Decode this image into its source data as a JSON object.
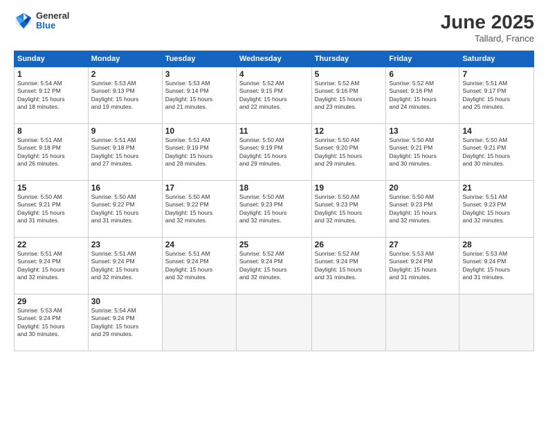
{
  "header": {
    "logo_general": "General",
    "logo_blue": "Blue",
    "month_title": "June 2025",
    "location": "Tallard, France"
  },
  "calendar": {
    "days_of_week": [
      "Sunday",
      "Monday",
      "Tuesday",
      "Wednesday",
      "Thursday",
      "Friday",
      "Saturday"
    ],
    "weeks": [
      [
        {
          "day": "",
          "empty": true
        },
        {
          "day": "2",
          "sunrise": "5:53 AM",
          "sunset": "9:13 PM",
          "daylight": "Daylight: 15 hours and 19 minutes."
        },
        {
          "day": "3",
          "sunrise": "5:53 AM",
          "sunset": "9:14 PM",
          "daylight": "Daylight: 15 hours and 21 minutes."
        },
        {
          "day": "4",
          "sunrise": "5:52 AM",
          "sunset": "9:15 PM",
          "daylight": "Daylight: 15 hours and 22 minutes."
        },
        {
          "day": "5",
          "sunrise": "5:52 AM",
          "sunset": "9:16 PM",
          "daylight": "Daylight: 15 hours and 23 minutes."
        },
        {
          "day": "6",
          "sunrise": "5:52 AM",
          "sunset": "9:16 PM",
          "daylight": "Daylight: 15 hours and 24 minutes."
        },
        {
          "day": "7",
          "sunrise": "5:51 AM",
          "sunset": "9:17 PM",
          "daylight": "Daylight: 15 hours and 25 minutes."
        }
      ],
      [
        {
          "day": "1",
          "sunrise": "5:54 AM",
          "sunset": "9:12 PM",
          "daylight": "Daylight: 15 hours and 18 minutes."
        },
        {
          "day": "",
          "empty": true
        },
        {
          "day": "",
          "empty": true
        },
        {
          "day": "",
          "empty": true
        },
        {
          "day": "",
          "empty": true
        },
        {
          "day": "",
          "empty": true
        },
        {
          "day": "",
          "empty": true
        }
      ],
      [
        {
          "day": "8",
          "sunrise": "5:51 AM",
          "sunset": "9:18 PM",
          "daylight": "Daylight: 15 hours and 26 minutes."
        },
        {
          "day": "9",
          "sunrise": "5:51 AM",
          "sunset": "9:18 PM",
          "daylight": "Daylight: 15 hours and 27 minutes."
        },
        {
          "day": "10",
          "sunrise": "5:51 AM",
          "sunset": "9:19 PM",
          "daylight": "Daylight: 15 hours and 28 minutes."
        },
        {
          "day": "11",
          "sunrise": "5:50 AM",
          "sunset": "9:19 PM",
          "daylight": "Daylight: 15 hours and 29 minutes."
        },
        {
          "day": "12",
          "sunrise": "5:50 AM",
          "sunset": "9:20 PM",
          "daylight": "Daylight: 15 hours and 29 minutes."
        },
        {
          "day": "13",
          "sunrise": "5:50 AM",
          "sunset": "9:21 PM",
          "daylight": "Daylight: 15 hours and 30 minutes."
        },
        {
          "day": "14",
          "sunrise": "5:50 AM",
          "sunset": "9:21 PM",
          "daylight": "Daylight: 15 hours and 30 minutes."
        }
      ],
      [
        {
          "day": "15",
          "sunrise": "5:50 AM",
          "sunset": "9:21 PM",
          "daylight": "Daylight: 15 hours and 31 minutes."
        },
        {
          "day": "16",
          "sunrise": "5:50 AM",
          "sunset": "9:22 PM",
          "daylight": "Daylight: 15 hours and 31 minutes."
        },
        {
          "day": "17",
          "sunrise": "5:50 AM",
          "sunset": "9:22 PM",
          "daylight": "Daylight: 15 hours and 32 minutes."
        },
        {
          "day": "18",
          "sunrise": "5:50 AM",
          "sunset": "9:23 PM",
          "daylight": "Daylight: 15 hours and 32 minutes."
        },
        {
          "day": "19",
          "sunrise": "5:50 AM",
          "sunset": "9:23 PM",
          "daylight": "Daylight: 15 hours and 32 minutes."
        },
        {
          "day": "20",
          "sunrise": "5:50 AM",
          "sunset": "9:23 PM",
          "daylight": "Daylight: 15 hours and 32 minutes."
        },
        {
          "day": "21",
          "sunrise": "5:51 AM",
          "sunset": "9:23 PM",
          "daylight": "Daylight: 15 hours and 32 minutes."
        }
      ],
      [
        {
          "day": "22",
          "sunrise": "5:51 AM",
          "sunset": "9:24 PM",
          "daylight": "Daylight: 15 hours and 32 minutes."
        },
        {
          "day": "23",
          "sunrise": "5:51 AM",
          "sunset": "9:24 PM",
          "daylight": "Daylight: 15 hours and 32 minutes."
        },
        {
          "day": "24",
          "sunrise": "5:51 AM",
          "sunset": "9:24 PM",
          "daylight": "Daylight: 15 hours and 32 minutes."
        },
        {
          "day": "25",
          "sunrise": "5:52 AM",
          "sunset": "9:24 PM",
          "daylight": "Daylight: 15 hours and 32 minutes."
        },
        {
          "day": "26",
          "sunrise": "5:52 AM",
          "sunset": "9:24 PM",
          "daylight": "Daylight: 15 hours and 31 minutes."
        },
        {
          "day": "27",
          "sunrise": "5:53 AM",
          "sunset": "9:24 PM",
          "daylight": "Daylight: 15 hours and 31 minutes."
        },
        {
          "day": "28",
          "sunrise": "5:53 AM",
          "sunset": "9:24 PM",
          "daylight": "Daylight: 15 hours and 31 minutes."
        }
      ],
      [
        {
          "day": "29",
          "sunrise": "5:53 AM",
          "sunset": "9:24 PM",
          "daylight": "Daylight: 15 hours and 30 minutes."
        },
        {
          "day": "30",
          "sunrise": "5:54 AM",
          "sunset": "9:24 PM",
          "daylight": "Daylight: 15 hours and 29 minutes."
        },
        {
          "day": "",
          "empty": true
        },
        {
          "day": "",
          "empty": true
        },
        {
          "day": "",
          "empty": true
        },
        {
          "day": "",
          "empty": true
        },
        {
          "day": "",
          "empty": true
        }
      ]
    ]
  }
}
